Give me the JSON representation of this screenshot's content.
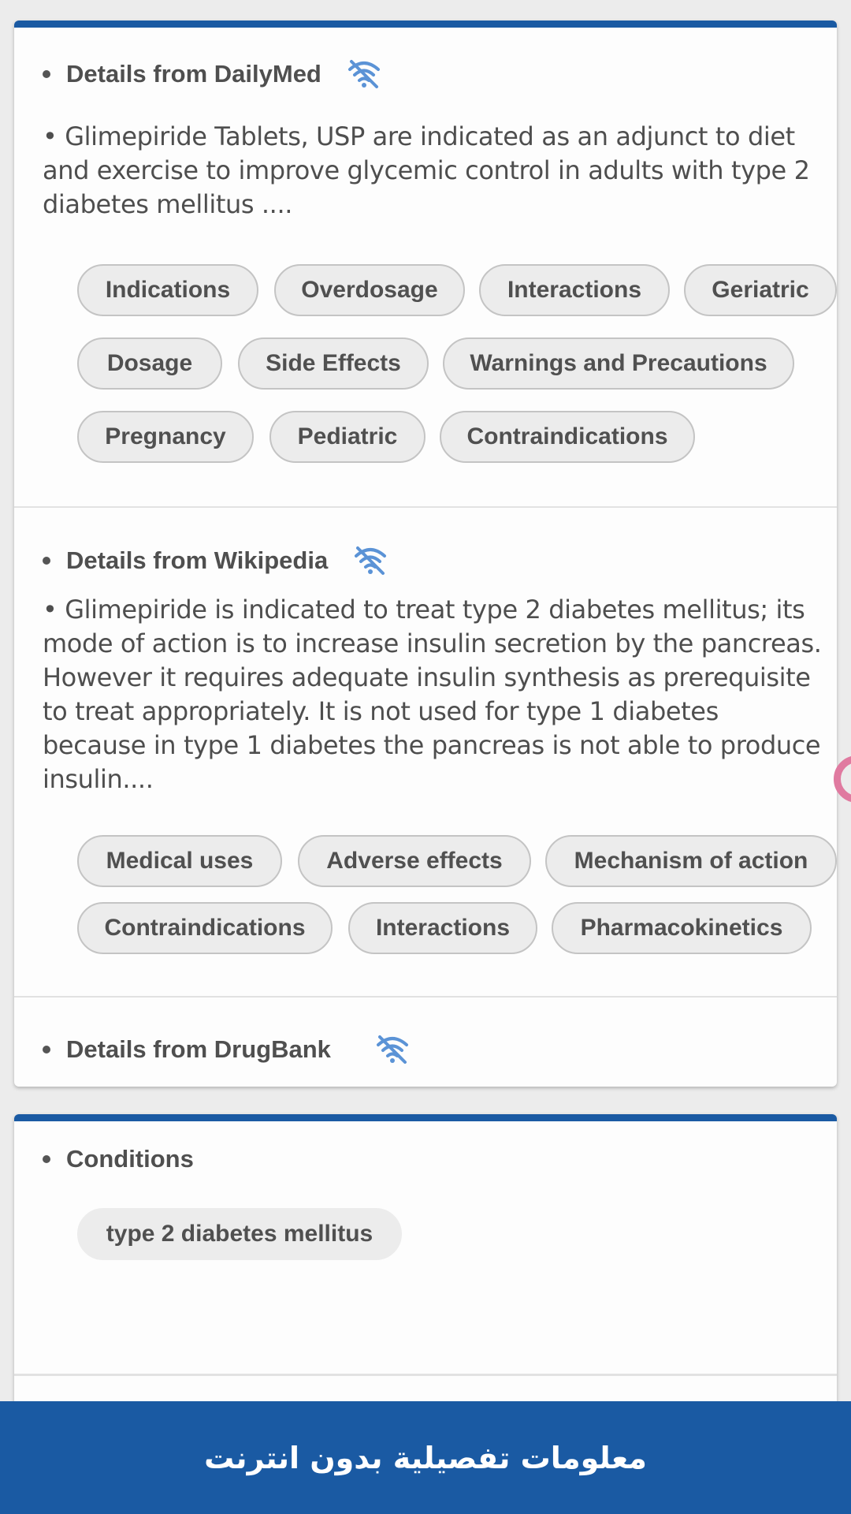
{
  "dailymed": {
    "heading": "Details from DailyMed",
    "description": "• Glimepiride Tablets, USP are indicated as an adjunct to diet and exercise to improve glycemic control in adults with type 2 diabetes mellitus ....",
    "chips": [
      "Indications",
      "Overdosage",
      "Interactions",
      "Geriatric",
      "Dosage",
      "Side Effects",
      "Warnings and Precautions",
      "Pregnancy",
      "Pediatric",
      "Contraindications"
    ]
  },
  "wikipedia": {
    "heading": "Details from Wikipedia",
    "description": "• Glimepiride is indicated to treat type 2 diabetes mellitus; its mode of action is to increase insulin secretion by the pancreas. However it requires adequate insulin synthesis as prerequisite to treat appropriately. It is not used for type 1 diabetes because in type 1 diabetes the pancreas is not able to produce insulin....",
    "chips": [
      "Medical uses",
      "Adverse effects",
      "Mechanism of action",
      "Contraindications",
      "Interactions",
      "Pharmacokinetics"
    ]
  },
  "drugbank": {
    "heading": "Details from DrugBank"
  },
  "conditions": {
    "heading": "Conditions",
    "chips": [
      "type 2 diabetes mellitus"
    ]
  },
  "bottom_bar": {
    "label": "معلومات تفصيلية بدون انترنت"
  },
  "icons": {
    "offline": "wifi-off-icon"
  },
  "colors": {
    "accent": "#1a5aa3",
    "icon": "#5b93d6",
    "chip_bg": "#ececec"
  }
}
